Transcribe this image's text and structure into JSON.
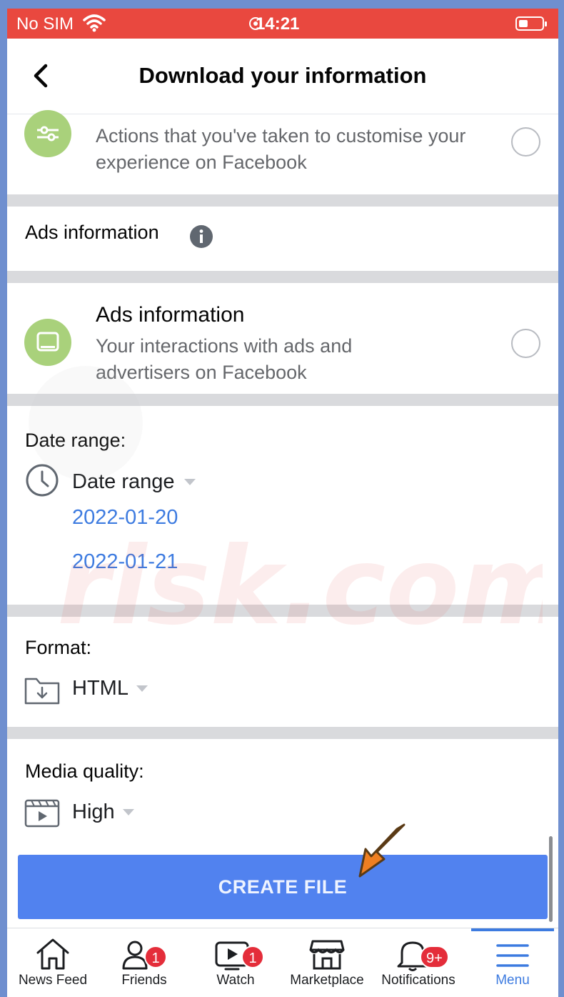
{
  "status_bar": {
    "carrier": "No SIM",
    "time": "14:21"
  },
  "header": {
    "title": "Download your information"
  },
  "rows": {
    "customise_sub": "Actions that you've taken to customise your experience on Facebook",
    "ads_section_title": "Ads information",
    "ads_item_title": "Ads information",
    "ads_item_sub": "Your interactions with ads and advertisers on Facebook"
  },
  "date_range": {
    "label": "Date range:",
    "dropdown": "Date range",
    "start": "2022-01-20",
    "end": "2022-01-21"
  },
  "format": {
    "label": "Format:",
    "value": "HTML"
  },
  "media_quality": {
    "label": "Media quality:",
    "value": "High"
  },
  "create_button": "CREATE FILE",
  "tabs": [
    {
      "label": "News Feed",
      "icon": "home-icon",
      "badge": ""
    },
    {
      "label": "Friends",
      "icon": "friends-icon",
      "badge": "1"
    },
    {
      "label": "Watch",
      "icon": "watch-icon",
      "badge": "1"
    },
    {
      "label": "Marketplace",
      "icon": "marketplace-icon",
      "badge": ""
    },
    {
      "label": "Notifications",
      "icon": "bell-icon",
      "badge": "9+"
    },
    {
      "label": "Menu",
      "icon": "menu-icon",
      "badge": ""
    }
  ],
  "colors": {
    "status_bar": "#e9483f",
    "accent": "#3d7be0",
    "create_button": "#5182ef",
    "badge": "#e42d3a",
    "icon_circle": "#a9d17b"
  }
}
